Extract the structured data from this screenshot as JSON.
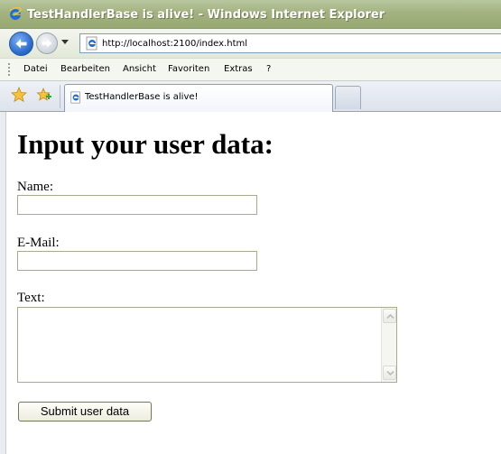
{
  "window": {
    "title": "TestHandlerBase is alive! - Windows Internet Explorer"
  },
  "navigation": {
    "address_url": "http://localhost:2100/index.html"
  },
  "menu": {
    "items": [
      {
        "label": "Datei"
      },
      {
        "label": "Bearbeiten"
      },
      {
        "label": "Ansicht"
      },
      {
        "label": "Favoriten"
      },
      {
        "label": "Extras"
      },
      {
        "label": "?"
      }
    ]
  },
  "tabs": {
    "active_label": "TestHandlerBase is alive!"
  },
  "page": {
    "heading": "Input your user data:",
    "name_label": "Name:",
    "name_value": "",
    "email_label": "E-Mail:",
    "email_value": "",
    "text_label": "Text:",
    "text_value": "",
    "submit_label": "Submit user data"
  },
  "colors": {
    "titlebar": "#a3b27f",
    "ie_blue": "#1c6fd6",
    "input_border": "#a5ac8f"
  },
  "icons": {
    "title": "ie-logo-icon",
    "back": "back-arrow-icon",
    "forward": "forward-arrow-icon",
    "address": "ie-page-icon",
    "favorites": "favorites-star-icon",
    "add_favorite": "add-favorite-icon",
    "tab": "ie-page-icon"
  }
}
